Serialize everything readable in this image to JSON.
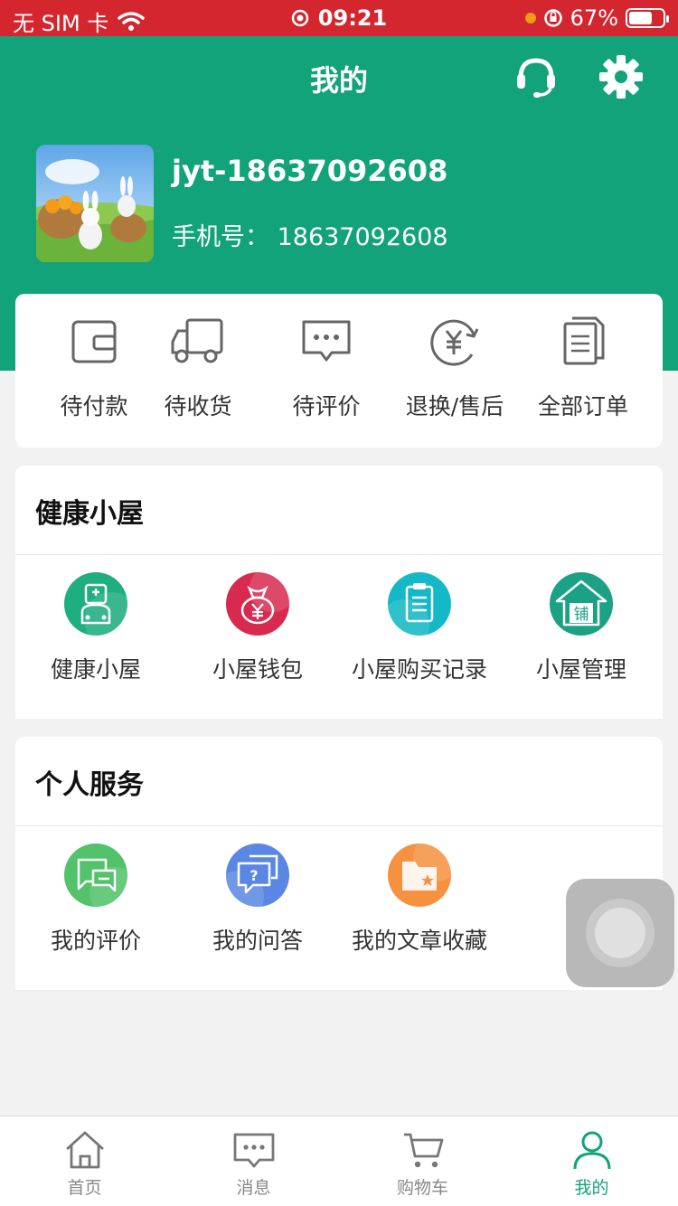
{
  "status_bar": {
    "carrier": "无 SIM 卡",
    "time": "09:21",
    "battery": "67%"
  },
  "header": {
    "title": "我的",
    "icons": [
      "headset-icon",
      "gear-icon"
    ]
  },
  "user": {
    "name": "jyt-18637092608",
    "phone_label": "手机号：",
    "phone": "18637092608"
  },
  "orders": [
    {
      "label": "待付款",
      "icon": "wallet-icon"
    },
    {
      "label": "待收货",
      "icon": "truck-icon"
    },
    {
      "label": "待评价",
      "icon": "chat-bubble-icon"
    },
    {
      "label": "退换/售后",
      "icon": "refund-icon"
    },
    {
      "label": "全部订单",
      "icon": "documents-icon"
    }
  ],
  "health_section": {
    "title": "健康小屋",
    "items": [
      {
        "label": "健康小屋",
        "icon": "doctor-icon",
        "color": "#1fae7f"
      },
      {
        "label": "小屋钱包",
        "icon": "money-bag-icon",
        "color": "#d82a4f"
      },
      {
        "label": "小屋购买记录",
        "icon": "clipboard-icon",
        "color": "#14b9c7"
      },
      {
        "label": "小屋管理",
        "icon": "shop-icon",
        "color": "#1ba184"
      }
    ]
  },
  "service_section": {
    "title": "个人服务",
    "items": [
      {
        "label": "我的评价",
        "icon": "review-icon",
        "color": "#52c36a"
      },
      {
        "label": "我的问答",
        "icon": "qa-icon",
        "color": "#5a87e4"
      },
      {
        "label": "我的文章收藏",
        "icon": "folder-star-icon",
        "color": "#f5913f"
      }
    ]
  },
  "tabs": [
    {
      "label": "首页",
      "icon": "home-icon",
      "active": false
    },
    {
      "label": "消息",
      "icon": "message-icon",
      "active": false
    },
    {
      "label": "购物车",
      "icon": "cart-icon",
      "active": false
    },
    {
      "label": "我的",
      "icon": "person-icon",
      "active": true
    }
  ],
  "colors": {
    "brand_green": "#12a37a",
    "status_red": "#d3262f"
  }
}
